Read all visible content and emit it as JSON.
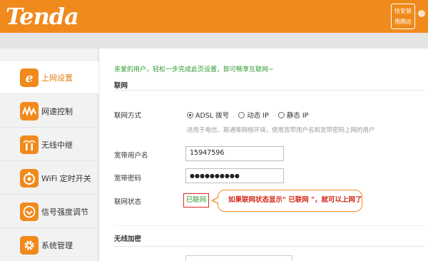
{
  "brand": {
    "logo": "Tenda",
    "badge_line1": "恰安装",
    "badge_line2": "用腾达",
    "accent": "#f08a1c"
  },
  "sidebar": {
    "items": [
      {
        "label": "上网设置",
        "icon": "ie-icon",
        "active": true
      },
      {
        "label": "网速控制",
        "icon": "speed-wave-icon",
        "active": false
      },
      {
        "label": "无线中继",
        "icon": "wireless-relay-icon",
        "active": false
      },
      {
        "label": "WiFi 定时开关",
        "icon": "power-icon",
        "active": false
      },
      {
        "label": "信号强度调节",
        "icon": "signal-strength-icon",
        "active": false
      },
      {
        "label": "系统管理",
        "icon": "gear-icon",
        "active": false
      }
    ]
  },
  "main": {
    "greeting": "亲爱的用户，轻松一步完成此页设置，即可畅享互联网~",
    "section_wan": "联网",
    "connection_mode_label": "联网方式",
    "modes": [
      {
        "label": "ADSL 拨号",
        "selected": true
      },
      {
        "label": "动态 IP",
        "selected": false
      },
      {
        "label": "静态 IP",
        "selected": false
      }
    ],
    "hint": "适用于电信、联通等网络环境，使用宽带用户名和宽带密码上网的用户",
    "username_label": "宽带用户名",
    "username_value": "15947596",
    "password_label": "宽带密码",
    "password_value": "●●●●●●●●●●",
    "status_label": "联网状态",
    "status_value": "已联网",
    "callout": "如果联网状态显示\" 已联网 \"，就可以上网了",
    "section_wireless": "无线加密"
  }
}
